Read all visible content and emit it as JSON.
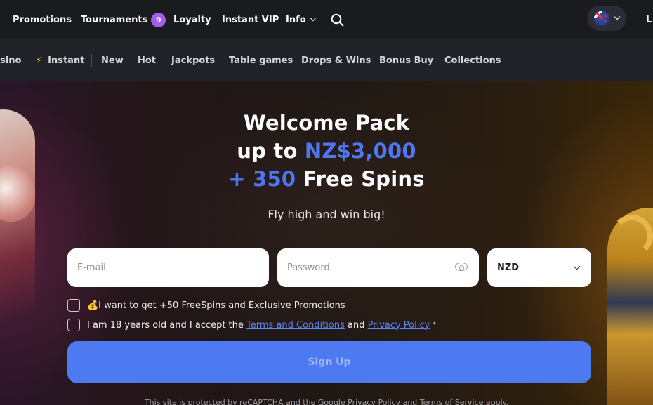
{
  "topnav": {
    "promotions": "Promotions",
    "tournaments": "Tournaments",
    "tournaments_count": "9",
    "loyalty": "Loyalty",
    "instant_vip": "Instant VIP",
    "info": "Info",
    "login_partial": "L"
  },
  "categories": {
    "casino_partial": "sino",
    "instant": "Instant",
    "instant_icon": "⚡",
    "items": [
      "New",
      "Hot",
      "Jackpots",
      "Table games",
      "Drops & Wins",
      "Bonus Buy",
      "Collections"
    ]
  },
  "hero": {
    "line1": "Welcome Pack",
    "line2_prefix": "up to ",
    "line2_amount": "NZ$3,000",
    "line3_prefix": "+ 350",
    "line3_suffix": " Free Spins",
    "tagline": "Fly high and win big!"
  },
  "form": {
    "email_placeholder": "E-mail",
    "password_placeholder": "Password",
    "currency": "NZD",
    "promo_text": "💰I want to get +50 FreeSpins and Exclusive Promotions",
    "age_text_1": "I am 18 years old and I accept the ",
    "terms_link": "Terms and Conditions",
    "age_text_2": " and ",
    "privacy_link": "Privacy Policy",
    "required_mark": "*",
    "signup_label": "Sign Up",
    "recaptcha_text": "This site is protected by reCAPTCHA and the Google Privacy Policy and Terms of Service apply."
  },
  "colors": {
    "accent": "#4f77f3",
    "badge": "#a25ee8",
    "signup_button": "#4d79f1"
  }
}
